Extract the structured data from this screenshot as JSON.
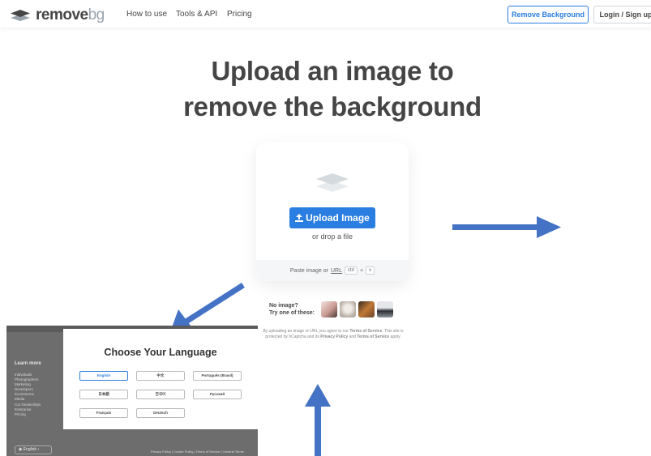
{
  "header": {
    "logo_main": "remove",
    "logo_bg": "bg",
    "nav": [
      "How to use",
      "Tools & API",
      "Pricing"
    ],
    "remove_background_button": "Remove Background",
    "login_button": "Login / Sign up"
  },
  "hero": {
    "title_line1": "Upload an image to",
    "title_line2": "remove the background"
  },
  "upload_card": {
    "upload_button": "Upload Image",
    "drop_text": "or drop a file",
    "paste_text": "Paste image or",
    "url_link": "URL",
    "shortcut_key1": "ctrl",
    "shortcut_plus": "+",
    "shortcut_key2": "v"
  },
  "samples": {
    "line1": "No image?",
    "line2": "Try one of these:"
  },
  "tos": {
    "close": "×",
    "text_start": "By uploading an image or URL you agree to our",
    "terms1": "Terms of Service",
    "text_mid": ". This site is protected by hCaptcha and its",
    "privacy": "Privacy Policy",
    "and": "and",
    "terms2": "Terms of Service",
    "text_end": "apply."
  },
  "language_modal": {
    "title": "Choose Your Language",
    "languages": [
      "English",
      "中文",
      "Português (Brasil)",
      "日本語",
      "한국어",
      "Русский",
      "Français",
      "Deutsch"
    ],
    "selected": "English",
    "learn_more": "Learn more",
    "learn_more_items": [
      "Individuals",
      "Photographers",
      "Marketing",
      "Developers",
      "Ecommerce",
      "Media",
      "Car Dealerships",
      "Enterprise",
      "Pricing"
    ],
    "language_pill": "English",
    "footer_links": "Privacy Policy | Cookie Policy | Terms of Service | General Terms"
  },
  "colors": {
    "accent": "#2a7de1",
    "annotation_arrow": "#4472c4",
    "text": "#454545"
  },
  "icons": [
    "logo-layers-icon",
    "upload-layers-icon",
    "upload-arrow-icon",
    "globe-icon",
    "close-icon"
  ]
}
